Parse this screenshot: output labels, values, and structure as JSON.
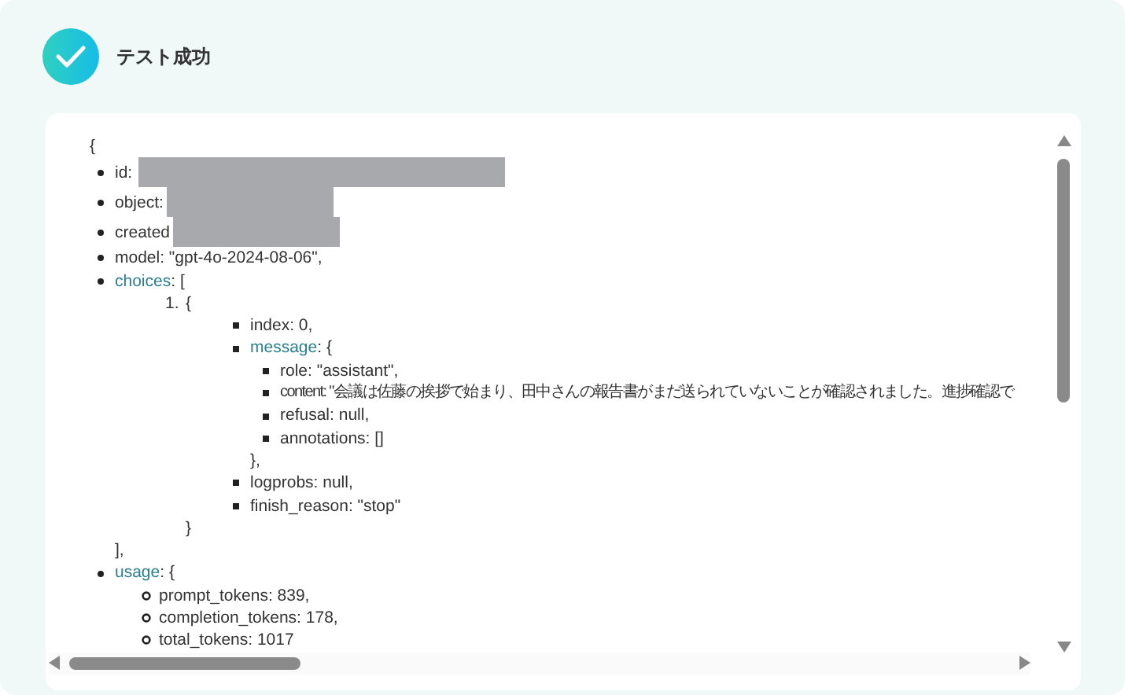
{
  "header": {
    "title": "テスト成功"
  },
  "tree": {
    "open": "{",
    "list": {
      "kind": "disc",
      "items": [
        {
          "text": "id:",
          "kind": "redacted_long"
        },
        {
          "text": "object:",
          "kind": "redacted_short"
        },
        {
          "text": "created",
          "kind": "redacted_short"
        },
        {
          "text": "model: \"gpt-4o-2024-08-06\","
        },
        {
          "key": "choices",
          "text": ": [",
          "close": "],",
          "list": {
            "kind": "number",
            "items": [
              {
                "number": "1.",
                "text": "{",
                "close": "}",
                "list": {
                  "kind": "square",
                  "items": [
                    {
                      "text": "index: 0,"
                    },
                    {
                      "key": "message",
                      "text": ": {",
                      "close": "},",
                      "list": {
                        "kind": "square",
                        "items": [
                          {
                            "text": "role: \"assistant\","
                          },
                          {
                            "text": "content: \"会議は佐藤の挨拶で始まり、田中さんの報告書がまだ送られていないことが確認されました。進捗確認で"
                          },
                          {
                            "text": "refusal: null,"
                          },
                          {
                            "text": "annotations: []"
                          }
                        ]
                      }
                    },
                    {
                      "text": "logprobs: null,"
                    },
                    {
                      "text": "finish_reason: \"stop\""
                    }
                  ]
                }
              }
            ]
          }
        },
        {
          "key": "usage",
          "text": ": {",
          "list": {
            "kind": "circle",
            "items": [
              {
                "text": "prompt_tokens: 839,"
              },
              {
                "text": "completion_tokens: 178,"
              },
              {
                "text": "total_tokens: 1017"
              }
            ]
          }
        }
      ]
    }
  }
}
